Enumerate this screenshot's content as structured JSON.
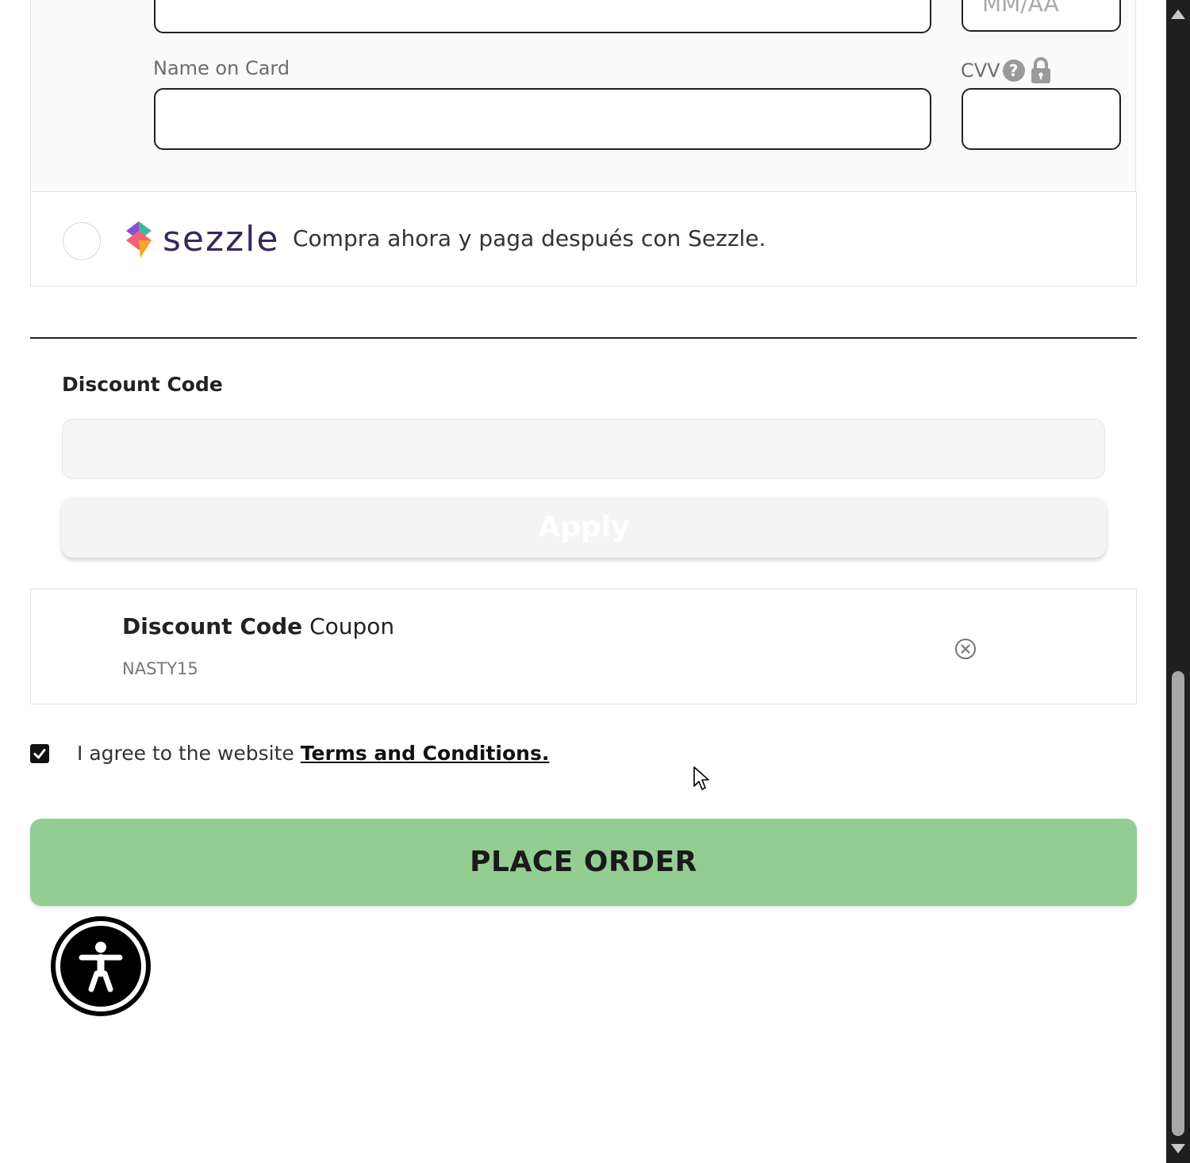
{
  "card_form": {
    "expiry_placeholder": "MM/AA",
    "name_label": "Name on Card",
    "cvv_label": "CVV",
    "cvv_help_symbol": "?"
  },
  "sezzle": {
    "brand": "sezzle",
    "description": "Compra ahora y paga después con Sezzle."
  },
  "discount": {
    "title": "Discount Code",
    "apply_label": "Apply"
  },
  "coupon": {
    "title_bold": "Discount Code",
    "title_suffix": "Coupon",
    "code": "NASTY15"
  },
  "agreement": {
    "text": "I agree to the website ",
    "link": "Terms and Conditions.",
    "checked": true
  },
  "place_order": {
    "label": "PLACE ORDER",
    "color": "#93cd92"
  },
  "icons": {
    "help": "question-circle-icon",
    "lock": "lock-icon",
    "remove": "close-circle-icon",
    "accessibility": "accessibility-icon"
  }
}
